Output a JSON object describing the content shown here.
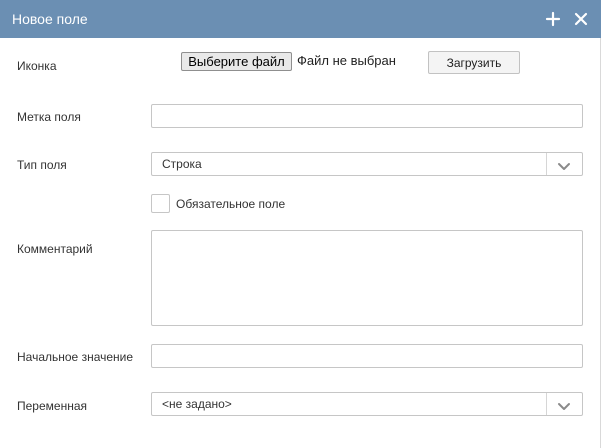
{
  "dialog": {
    "title": "Новое поле",
    "add_icon": "plus-icon",
    "close_icon": "close-icon"
  },
  "icon_row": {
    "label": "Иконка",
    "file_button_label": "Выберите файл",
    "file_status": "Файл не выбран",
    "upload_button_label": "Загрузить"
  },
  "field_label": {
    "label": "Метка поля",
    "value": ""
  },
  "field_type": {
    "label": "Тип поля",
    "selected": "Строка",
    "chevron_icon": "chevron-down-icon"
  },
  "required": {
    "label": "Обязательное поле",
    "checked": false
  },
  "comment": {
    "label": "Комментарий",
    "value": ""
  },
  "initial_value": {
    "label": "Начальное значение",
    "value": ""
  },
  "variable": {
    "label": "Переменная",
    "selected": "<не задано>",
    "chevron_icon": "chevron-down-icon"
  },
  "colors": {
    "titlebar": "#6b8fb3",
    "border": "#c6c6c6",
    "text": "#333333"
  }
}
